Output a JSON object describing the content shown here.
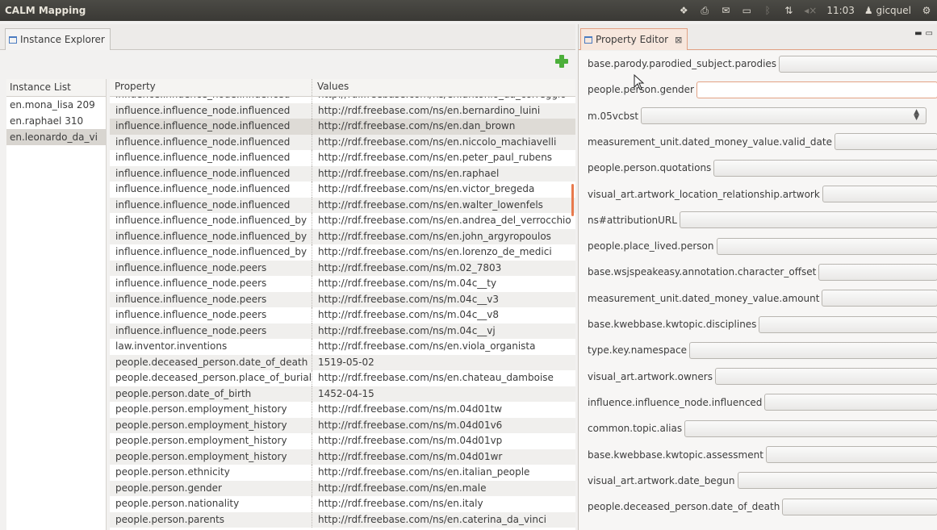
{
  "window": {
    "title": "CALM Mapping",
    "clock": "11:03",
    "user": "gicquel",
    "indicators": [
      "dropbox-icon",
      "printer-icon",
      "mail-icon",
      "battery-icon",
      "bluetooth-icon",
      "network-icon",
      "volume-icon"
    ]
  },
  "instance_explorer": {
    "tab_label": "Instance Explorer",
    "add_label": "+",
    "list_header": "Instance List",
    "instances": [
      "en.mona_lisa 209",
      "en.raphael 310",
      "en.leonardo_da_vi"
    ],
    "selected_instance": 2,
    "columns": [
      "Property",
      "Values"
    ],
    "rows": [
      [
        "influence.influence_node.influenced",
        "http://rdf.freebase.com/ns/en.antonio_da_correggio"
      ],
      [
        "influence.influence_node.influenced",
        "http://rdf.freebase.com/ns/en.bernardino_luini"
      ],
      [
        "influence.influence_node.influenced",
        "http://rdf.freebase.com/ns/en.dan_brown"
      ],
      [
        "influence.influence_node.influenced",
        "http://rdf.freebase.com/ns/en.niccolo_machiavelli"
      ],
      [
        "influence.influence_node.influenced",
        "http://rdf.freebase.com/ns/en.peter_paul_rubens"
      ],
      [
        "influence.influence_node.influenced",
        "http://rdf.freebase.com/ns/en.raphael"
      ],
      [
        "influence.influence_node.influenced",
        "http://rdf.freebase.com/ns/en.victor_bregeda"
      ],
      [
        "influence.influence_node.influenced",
        "http://rdf.freebase.com/ns/en.walter_lowenfels"
      ],
      [
        "influence.influence_node.influenced_by",
        "http://rdf.freebase.com/ns/en.andrea_del_verrocchio"
      ],
      [
        "influence.influence_node.influenced_by",
        "http://rdf.freebase.com/ns/en.john_argyropoulos"
      ],
      [
        "influence.influence_node.influenced_by",
        "http://rdf.freebase.com/ns/en.lorenzo_de_medici"
      ],
      [
        "influence.influence_node.peers",
        "http://rdf.freebase.com/ns/m.02_7803"
      ],
      [
        "influence.influence_node.peers",
        "http://rdf.freebase.com/ns/m.04c__ty"
      ],
      [
        "influence.influence_node.peers",
        "http://rdf.freebase.com/ns/m.04c__v3"
      ],
      [
        "influence.influence_node.peers",
        "http://rdf.freebase.com/ns/m.04c__v8"
      ],
      [
        "influence.influence_node.peers",
        "http://rdf.freebase.com/ns/m.04c__vj"
      ],
      [
        "law.inventor.inventions",
        "http://rdf.freebase.com/ns/en.viola_organista"
      ],
      [
        "people.deceased_person.date_of_death",
        "1519-05-02"
      ],
      [
        "people.deceased_person.place_of_burial",
        "http://rdf.freebase.com/ns/en.chateau_damboise"
      ],
      [
        "people.person.date_of_birth",
        "1452-04-15"
      ],
      [
        "people.person.employment_history",
        "http://rdf.freebase.com/ns/m.04d01tw"
      ],
      [
        "people.person.employment_history",
        "http://rdf.freebase.com/ns/m.04d01v6"
      ],
      [
        "people.person.employment_history",
        "http://rdf.freebase.com/ns/m.04d01vp"
      ],
      [
        "people.person.employment_history",
        "http://rdf.freebase.com/ns/m.04d01wr"
      ],
      [
        "people.person.ethnicity",
        "http://rdf.freebase.com/ns/en.italian_people"
      ],
      [
        "people.person.gender",
        "http://rdf.freebase.com/ns/en.male"
      ],
      [
        "people.person.nationality",
        "http://rdf.freebase.com/ns/en.italy"
      ],
      [
        "people.person.parents",
        "http://rdf.freebase.com/ns/en.caterina_da_vinci"
      ]
    ],
    "selected_row": 2
  },
  "property_editor": {
    "tab_label": "Property Editor",
    "fields": [
      {
        "label": "base.parody.parodied_subject.parodies",
        "value": "",
        "kind": "text"
      },
      {
        "label": "people.person.gender",
        "value": "",
        "kind": "text",
        "focused": true
      },
      {
        "label": "m.05vcbst",
        "value": "",
        "kind": "combo"
      },
      {
        "label": "measurement_unit.dated_money_value.valid_date",
        "value": "",
        "kind": "text"
      },
      {
        "label": "people.person.quotations",
        "value": "",
        "kind": "text"
      },
      {
        "label": "visual_art.artwork_location_relationship.artwork",
        "value": "",
        "kind": "text"
      },
      {
        "label": "ns#attributionURL",
        "value": "",
        "kind": "text"
      },
      {
        "label": "people.place_lived.person",
        "value": "",
        "kind": "text"
      },
      {
        "label": "base.wsjspeakeasy.annotation.character_offset",
        "value": "",
        "kind": "text"
      },
      {
        "label": "measurement_unit.dated_money_value.amount",
        "value": "",
        "kind": "text"
      },
      {
        "label": "base.kwebbase.kwtopic.disciplines",
        "value": "",
        "kind": "text"
      },
      {
        "label": "type.key.namespace",
        "value": "",
        "kind": "text"
      },
      {
        "label": "visual_art.artwork.owners",
        "value": "",
        "kind": "text"
      },
      {
        "label": "influence.influence_node.influenced",
        "value": "",
        "kind": "text"
      },
      {
        "label": "common.topic.alias",
        "value": "",
        "kind": "text"
      },
      {
        "label": "base.kwebbase.kwtopic.assessment",
        "value": "",
        "kind": "text"
      },
      {
        "label": "visual_art.artwork.date_begun",
        "value": "",
        "kind": "text"
      },
      {
        "label": "people.deceased_person.date_of_death",
        "value": "",
        "kind": "text"
      }
    ]
  }
}
